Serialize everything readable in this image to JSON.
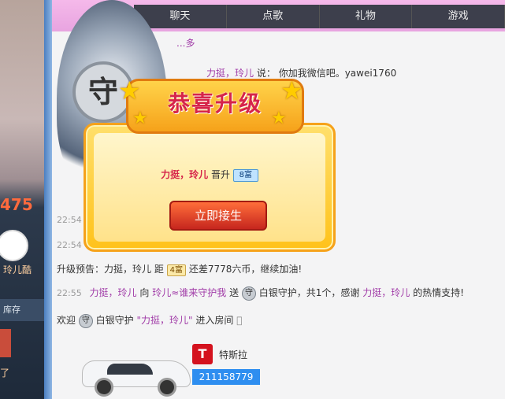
{
  "nav": {
    "tabs": [
      "聊天",
      "点歌",
      "礼物",
      "游戏"
    ]
  },
  "sidebar": {
    "score": "475",
    "avatar_tag": "玲儿酷",
    "stock_label": "库存",
    "bottom_tag": "了"
  },
  "chat": {
    "header_link": "...多",
    "line1": {
      "user": "力挺，玲儿",
      "verb": "说：",
      "text": "你加我微信吧。yawei1760"
    },
    "line_t1": {
      "time": "22:54"
    },
    "line_t2": {
      "time": "22:54"
    },
    "upgrade_notice": {
      "prefix": "升级预告：力挺，玲儿 距",
      "medal": "4富",
      "suffix": "还差7778六币，继续加油!"
    },
    "gift_line": {
      "time": "22:55",
      "user": "力挺，玲儿",
      "to": "向",
      "target": "玲儿≈谁来守护我",
      "send": "送",
      "shield": "守",
      "gift": "白银守护，共1个，感谢",
      "user2": "力挺，玲儿",
      "end": "的热情支持!"
    },
    "welcome_line": {
      "welcome": "欢迎",
      "shield": "守",
      "text": "白银守护",
      "name": "\"力挺，玲儿\"",
      "end": "进入房间"
    },
    "car_gift": {
      "name": "特斯拉",
      "id": "211158779",
      "logo": "T"
    }
  },
  "overlay": {
    "emblem": "守",
    "title": "恭喜升级",
    "user": "力挺，玲儿",
    "verb": "晋升",
    "level": "8富",
    "button": "立即接生"
  },
  "colors": {
    "accent": "#d6244a",
    "user": "#a03aa7",
    "nav_bg": "#3d3f4c",
    "gold": "#ffc21a"
  }
}
